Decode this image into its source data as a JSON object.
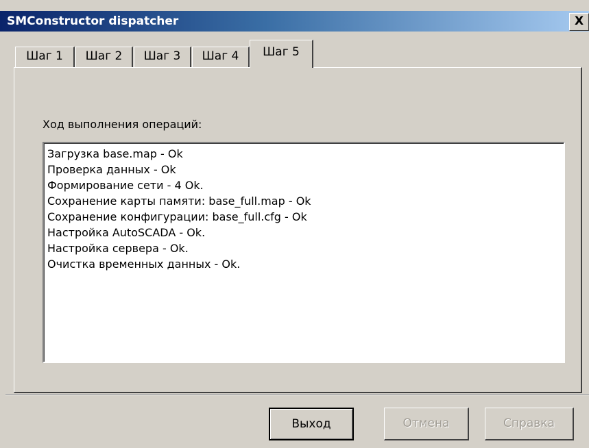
{
  "window": {
    "title": "SMConstructor dispatcher",
    "close_glyph": "X",
    "close_icon": "close-icon"
  },
  "tabs": [
    {
      "label": "Шаг 1",
      "active": false
    },
    {
      "label": "Шаг 2",
      "active": false
    },
    {
      "label": "Шаг 3",
      "active": false
    },
    {
      "label": "Шаг 4",
      "active": false
    },
    {
      "label": "Шаг 5",
      "active": true
    }
  ],
  "main": {
    "progress_label": "Ход выполнения операций:",
    "log_lines": [
      "Загрузка base.map - Ok",
      "Проверка данных - Ok",
      "Формирование сети - 4 Ok.",
      "Сохранение карты памяти: base_full.map - Ok",
      "Сохранение конфигурации: base_full.cfg - Ok",
      "Настройка AutoSCADA - Ok.",
      "Настройка сервера - Ok.",
      "Очистка временных данных - Ok."
    ]
  },
  "buttons": {
    "exit_label": "Выход",
    "cancel_label": "Отмена",
    "help_label": "Справка"
  },
  "colors": {
    "face": "#d4d0c8",
    "title_start": "#0a246a",
    "title_end": "#a6caf0",
    "disabled_text": "#a09c94"
  }
}
